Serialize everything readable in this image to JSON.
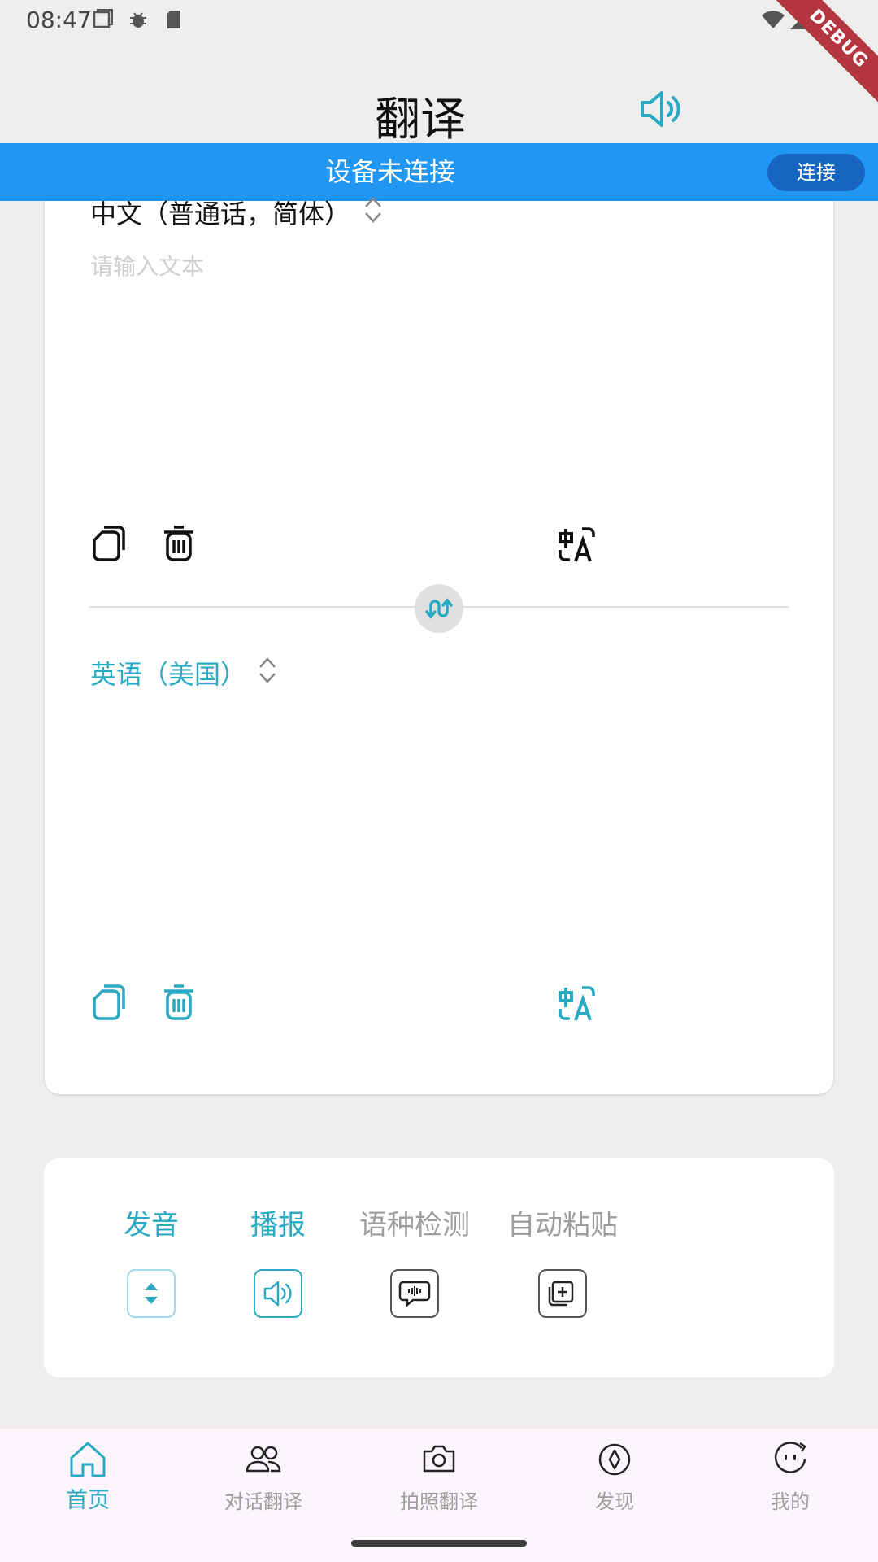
{
  "status_bar": {
    "time": "08:47",
    "debug_label": "DEBUG"
  },
  "app_bar": {
    "title": "翻译"
  },
  "banner": {
    "text": "设备未连接",
    "connect_label": "连接"
  },
  "source": {
    "language": "中文（普通话，简体）",
    "placeholder": "请输入文本"
  },
  "target": {
    "language": "英语（美国）"
  },
  "settings": {
    "items": [
      {
        "label": "发音",
        "icon": "sort-icon",
        "active": true
      },
      {
        "label": "播报",
        "icon": "speaker-icon",
        "active": true
      },
      {
        "label": "语种检测",
        "icon": "voice-message-icon",
        "active": false
      },
      {
        "label": "自动粘贴",
        "icon": "paste-icon",
        "active": false
      }
    ]
  },
  "bottom_nav": {
    "items": [
      {
        "label": "首页",
        "icon": "home-icon",
        "active": true
      },
      {
        "label": "对话翻译",
        "icon": "people-icon",
        "active": false
      },
      {
        "label": "拍照翻译",
        "icon": "camera-icon",
        "active": false
      },
      {
        "label": "发现",
        "icon": "compass-icon",
        "active": false
      },
      {
        "label": "我的",
        "icon": "face-icon",
        "active": false
      }
    ]
  },
  "colors": {
    "accent": "#29a9c2",
    "banner": "#2196f3",
    "connect_button": "#1565c0",
    "inactive": "#9e9e9e"
  }
}
